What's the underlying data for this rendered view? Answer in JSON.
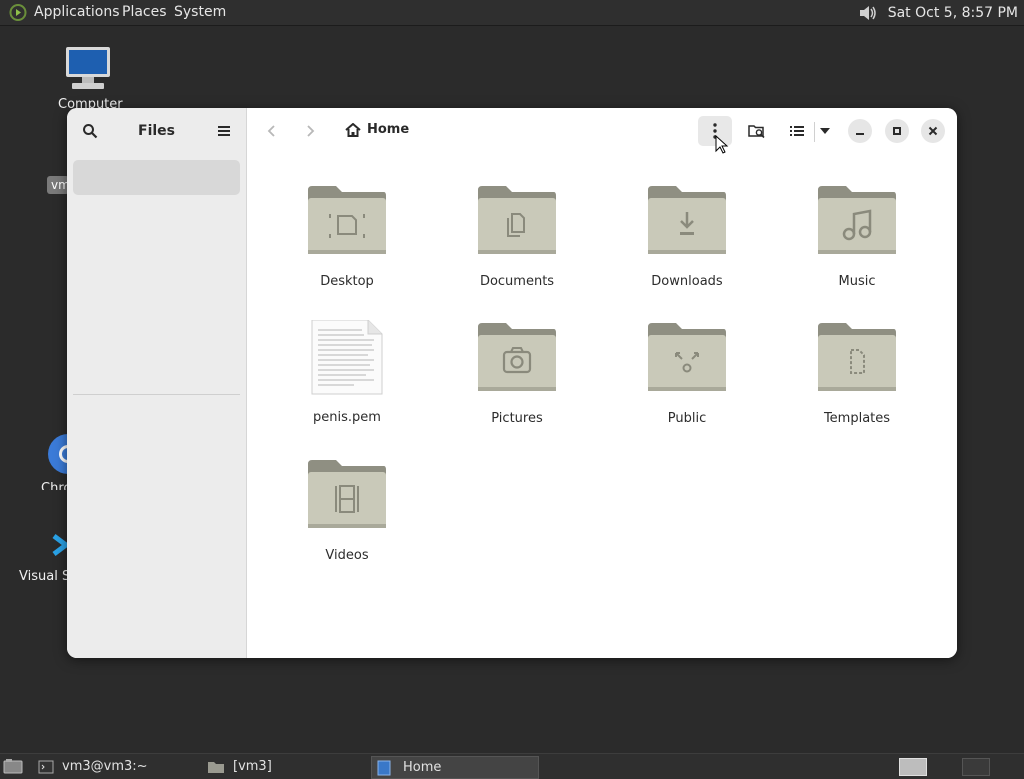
{
  "top_panel": {
    "menus": [
      "Applications",
      "Places",
      "System"
    ],
    "clock": "Sat Oct  5,  8:57 PM"
  },
  "desktop": {
    "icons": [
      {
        "label": "Computer"
      },
      {
        "label": "Chro"
      },
      {
        "label": "Visual St"
      }
    ],
    "tooltip": "vm"
  },
  "window": {
    "sidebar_title": "Files",
    "location": "Home",
    "items": [
      {
        "name": "Desktop",
        "icon": "folder-desktop-icon"
      },
      {
        "name": "Documents",
        "icon": "folder-documents-icon"
      },
      {
        "name": "Downloads",
        "icon": "folder-downloads-icon"
      },
      {
        "name": "Music",
        "icon": "folder-music-icon"
      },
      {
        "name": "penis.pem",
        "icon": "text-file-icon"
      },
      {
        "name": "Pictures",
        "icon": "folder-pictures-icon"
      },
      {
        "name": "Public",
        "icon": "folder-public-icon"
      },
      {
        "name": "Templates",
        "icon": "folder-templates-icon"
      },
      {
        "name": "Videos",
        "icon": "folder-videos-icon"
      }
    ]
  },
  "taskbar": {
    "tasks": [
      {
        "label": "vm3@vm3:~",
        "active": false
      },
      {
        "label": "[vm3]",
        "active": false
      },
      {
        "label": "Home",
        "active": true
      }
    ]
  },
  "colors": {
    "panel_bg": "#2f2f2f",
    "desktop_bg": "#2b2b2b",
    "folder_body": "#c9c9b9",
    "folder_tab": "#8f8f82"
  }
}
